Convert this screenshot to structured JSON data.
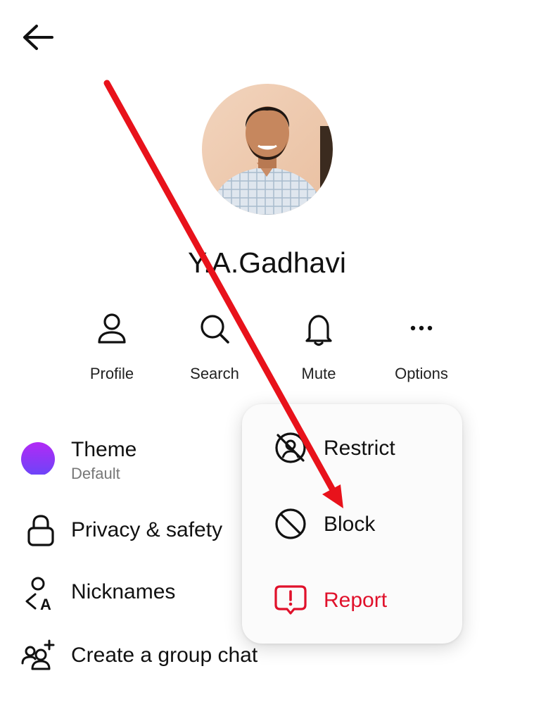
{
  "header": {
    "back_icon": "arrow-left-icon"
  },
  "profile": {
    "name": "Y.A.Gadhavi",
    "avatar": "profile-photo"
  },
  "actions": [
    {
      "label": "Profile",
      "icon": "person-icon"
    },
    {
      "label": "Search",
      "icon": "search-icon"
    },
    {
      "label": "Mute",
      "icon": "bell-icon"
    },
    {
      "label": "Options",
      "icon": "more-horizontal-icon"
    }
  ],
  "settings": {
    "theme": {
      "label": "Theme",
      "value": "Default",
      "icon": "theme-circle-icon"
    },
    "privacy": {
      "label": "Privacy & safety",
      "icon": "lock-icon"
    },
    "nicknames": {
      "label": "Nicknames",
      "icon": "nickname-icon"
    },
    "group": {
      "label": "Create a group chat",
      "icon": "add-group-icon"
    }
  },
  "options_menu": {
    "restrict": {
      "label": "Restrict",
      "icon": "restrict-icon"
    },
    "block": {
      "label": "Block",
      "icon": "block-icon"
    },
    "report": {
      "label": "Report",
      "icon": "report-icon"
    }
  },
  "colors": {
    "report_red": "#e0112b",
    "annotation_arrow": "#e8121b",
    "theme_gradient_start": "#a12cf5",
    "theme_gradient_end": "#7a3bf7"
  }
}
